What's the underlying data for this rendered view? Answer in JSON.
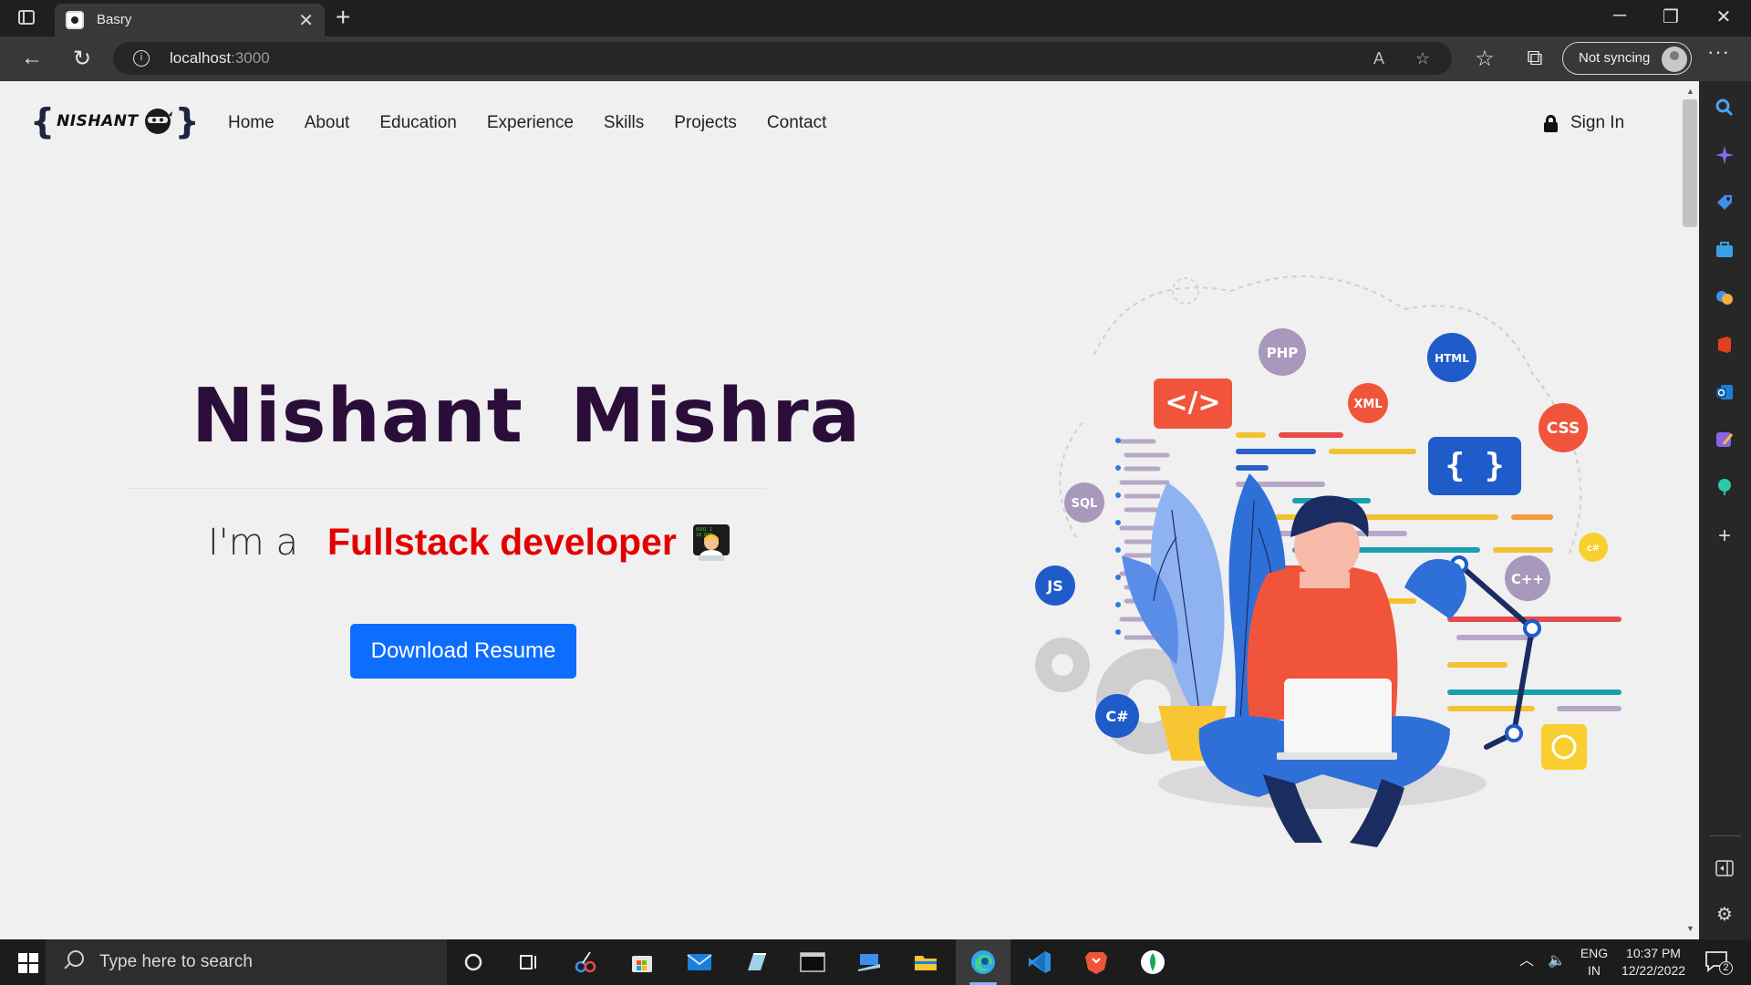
{
  "browser": {
    "tab_title": "Basry",
    "url_host": "localhost",
    "url_port": ":3000",
    "sync_label": "Not syncing"
  },
  "site": {
    "logo_text": "NISHANT",
    "logo_brace_open": "{",
    "logo_brace_close": "}",
    "nav": [
      "Home",
      "About",
      "Education",
      "Experience",
      "Skills",
      "Projects",
      "Contact"
    ],
    "signin_label": "Sign In"
  },
  "hero": {
    "name": "Nishant Mishra",
    "prefix": "I'm a",
    "role": "Fullstack developer",
    "button_label": "Download Resume",
    "button_color": "#0d6efd",
    "name_color": "#2b0d3a",
    "role_color": "#e30000"
  },
  "illustration": {
    "badges": [
      "PHP",
      "HTML",
      "XML",
      "CSS",
      "SQL",
      "JS",
      "C++",
      "C#",
      "c#"
    ],
    "code_tag": "</>",
    "braces": "{ }"
  },
  "taskbar": {
    "search_placeholder": "Type here to search",
    "lang_top": "ENG",
    "lang_bottom": "IN",
    "time": "10:37 PM",
    "date": "12/22/2022",
    "notification_count": "2"
  }
}
